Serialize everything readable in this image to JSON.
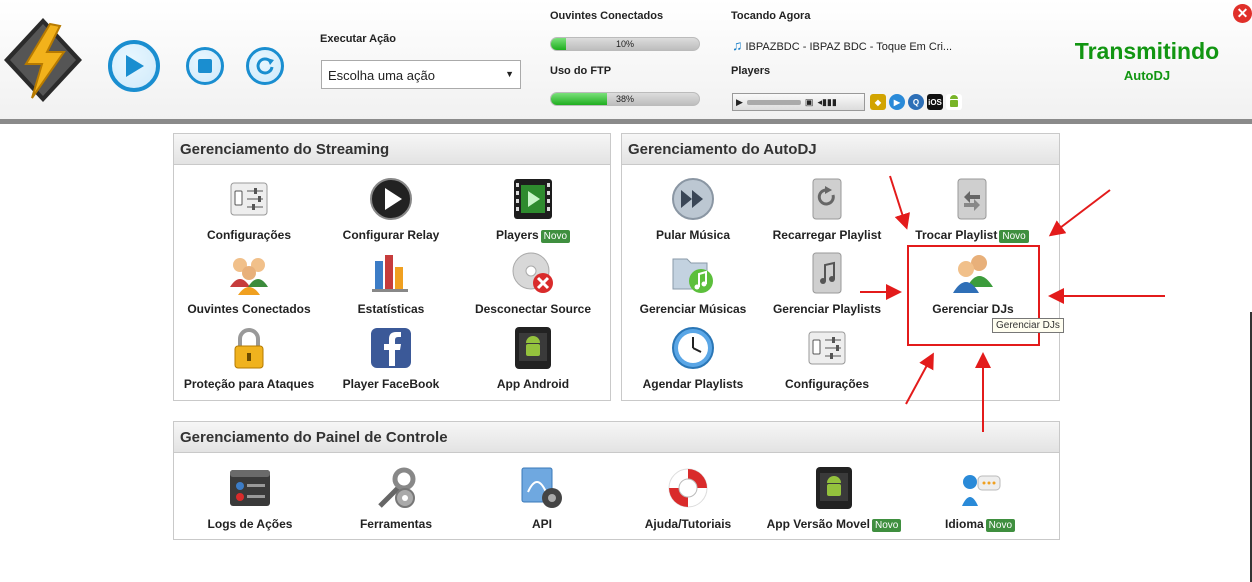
{
  "header": {
    "execute_label": "Executar Ação",
    "execute_select": "Escolha uma ação",
    "listeners_label": "Ouvintes Conectados",
    "listeners_percent": "10%",
    "listeners_value": 0.1,
    "ftp_label": "Uso do FTP",
    "ftp_percent": "38%",
    "ftp_value": 0.38,
    "now_playing_label": "Tocando Agora",
    "now_playing_song": "IBPAZBDC - IBPAZ BDC - Toque Em Cri...",
    "players_label": "Players",
    "status": "Transmitindo",
    "status_sub": "AutoDJ",
    "status_color": "#129612",
    "accent_color": "#1a8ed0"
  },
  "panels": {
    "streaming": {
      "title": "Gerenciamento do Streaming",
      "items": [
        {
          "label": "Configurações",
          "icon": "sliders-icon"
        },
        {
          "label": "Configurar Relay",
          "icon": "play-circle-icon"
        },
        {
          "label": "Players",
          "icon": "film-icon",
          "badge": "Novo"
        },
        {
          "label": "Ouvintes Conectados",
          "icon": "users-group-icon"
        },
        {
          "label": "Estatísticas",
          "icon": "bar-chart-icon"
        },
        {
          "label": "Desconectar Source",
          "icon": "disc-remove-icon"
        },
        {
          "label": "Proteção para Ataques",
          "icon": "padlock-icon"
        },
        {
          "label": "Player FaceBook",
          "icon": "facebook-icon"
        },
        {
          "label": "App Android",
          "icon": "android-phone-icon"
        }
      ]
    },
    "autodj": {
      "title": "Gerenciamento do AutoDJ",
      "items": [
        {
          "label": "Pular Música",
          "icon": "fast-forward-icon"
        },
        {
          "label": "Recarregar Playlist",
          "icon": "reload-file-icon"
        },
        {
          "label": "Trocar Playlist",
          "icon": "swap-file-icon",
          "badge": "Novo"
        },
        {
          "label": "Gerenciar Músicas",
          "icon": "music-folder-icon"
        },
        {
          "label": "Gerenciar Playlists",
          "icon": "music-file-icon"
        },
        {
          "label": "Gerenciar DJs",
          "icon": "users-icon"
        },
        {
          "label": "Agendar Playlists",
          "icon": "clock-icon"
        },
        {
          "label": "Configurações",
          "icon": "sliders-icon"
        }
      ],
      "tooltip": "Gerenciar DJs"
    },
    "control": {
      "title": "Gerenciamento do Painel de Controle",
      "items": [
        {
          "label": "Logs de Ações",
          "icon": "log-window-icon"
        },
        {
          "label": "Ferramentas",
          "icon": "tools-icon"
        },
        {
          "label": "API",
          "icon": "api-gear-icon"
        },
        {
          "label": "Ajuda/Tutoriais",
          "icon": "lifebuoy-icon"
        },
        {
          "label": "App Versão Movel",
          "icon": "android-phone-icon",
          "badge": "Novo"
        },
        {
          "label": "Idioma",
          "icon": "speech-icon",
          "badge": "Novo"
        }
      ]
    }
  }
}
